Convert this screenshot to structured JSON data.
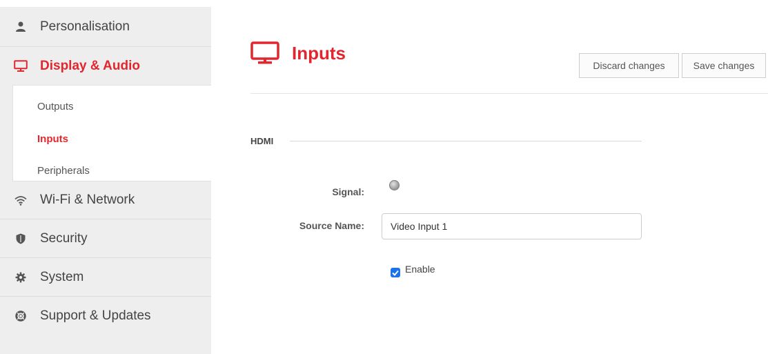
{
  "sidebar": {
    "items": [
      {
        "label": "Personalisation",
        "icon": "user-icon"
      },
      {
        "label": "Display & Audio",
        "icon": "monitor-icon",
        "active": true
      },
      {
        "label": "Wi-Fi & Network",
        "icon": "wifi-icon"
      },
      {
        "label": "Security",
        "icon": "shield-icon"
      },
      {
        "label": "System",
        "icon": "gear-icon"
      },
      {
        "label": "Support & Updates",
        "icon": "lifebuoy-icon"
      }
    ],
    "subitems": [
      {
        "label": "Outputs"
      },
      {
        "label": "Inputs",
        "active": true
      },
      {
        "label": "Peripherals"
      }
    ]
  },
  "header": {
    "title": "Inputs",
    "icon": "monitor-icon",
    "discard_label": "Discard changes",
    "save_label": "Save changes"
  },
  "section": {
    "title": "HDMI",
    "signal_label": "Signal:",
    "signal_state": "inactive",
    "source_name_label": "Source Name:",
    "source_name_value": "Video Input 1",
    "enable_label": "Enable",
    "enable_checked": true
  },
  "colors": {
    "accent": "#e3262e",
    "sidebar_bg": "#eeeeee",
    "checkbox": "#1a73e8"
  }
}
